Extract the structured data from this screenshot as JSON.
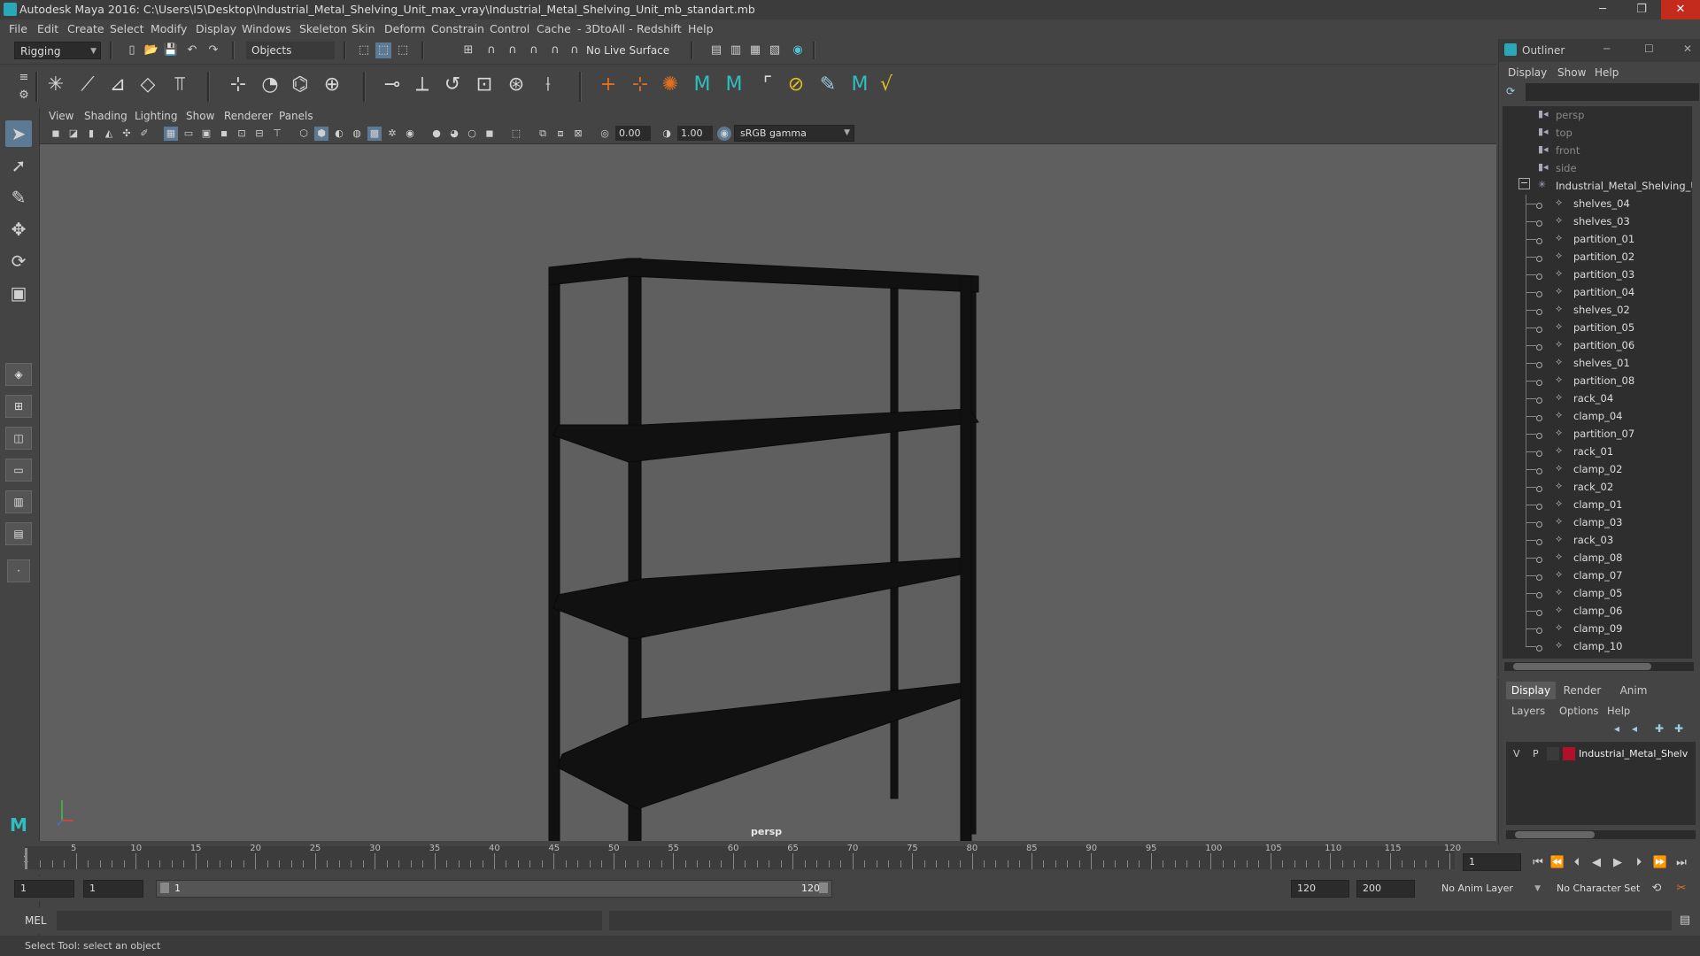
{
  "window": {
    "title": "Autodesk Maya 2016: C:\\Users\\I5\\Desktop\\Industrial_Metal_Shelving_Unit_max_vray\\Industrial_Metal_Shelving_Unit_mb_standart.mb",
    "min": "─",
    "max": "❐",
    "close": "✕"
  },
  "menubar": [
    "File",
    "Edit",
    "Create",
    "Select",
    "Modify",
    "Display",
    "Windows",
    "Skeleton",
    "Skin",
    "Deform",
    "Constrain",
    "Control",
    "Cache",
    "- 3DtoAll -",
    "Redshift",
    "Help"
  ],
  "statusline": {
    "mode": "Rigging",
    "select_mode": "Objects",
    "live_surface": "No Live Surface"
  },
  "viewport": {
    "menu": [
      "View",
      "Shading",
      "Lighting",
      "Show",
      "Renderer",
      "Panels"
    ],
    "exposure": "0.00",
    "gamma": "1.00",
    "color_space": "sRGB gamma",
    "camera_label": "persp"
  },
  "timeslider": {
    "ticks": [
      5,
      10,
      15,
      20,
      25,
      30,
      35,
      40,
      45,
      50,
      55,
      60,
      65,
      70,
      75,
      80,
      85,
      90,
      95,
      100,
      105,
      110,
      115,
      120
    ],
    "start_label": "1",
    "current_frame": "1"
  },
  "rangeslider": {
    "start": "1",
    "playback_start": "1",
    "bar_start": "1",
    "bar_end": "120",
    "playback_end": "120",
    "end": "200",
    "anim_layer": "No Anim Layer",
    "char_set": "No Character Set"
  },
  "cmdline": {
    "label": "MEL"
  },
  "helpline": {
    "text": "Select Tool: select an object"
  },
  "outliner": {
    "title": "Outliner",
    "menu": [
      "Display",
      "Show",
      "Help"
    ],
    "cameras": [
      "persp",
      "top",
      "front",
      "side"
    ],
    "root": "Industrial_Metal_Shelving_Uni",
    "children": [
      "shelves_04",
      "shelves_03",
      "partition_01",
      "partition_02",
      "partition_03",
      "partition_04",
      "shelves_02",
      "partition_05",
      "partition_06",
      "shelves_01",
      "partition_08",
      "rack_04",
      "clamp_04",
      "partition_07",
      "rack_01",
      "clamp_02",
      "rack_02",
      "clamp_01",
      "clamp_03",
      "rack_03",
      "clamp_08",
      "clamp_07",
      "clamp_05",
      "clamp_06",
      "clamp_09",
      "clamp_10"
    ]
  },
  "layer_editor": {
    "tabs": [
      "Display",
      "Render",
      "Anim"
    ],
    "menu": [
      "Layers",
      "Options",
      "Help"
    ],
    "layer": {
      "v": "V",
      "p": "P",
      "name": "Industrial_Metal_Shelv",
      "color": "#b0102a"
    }
  },
  "colors": {
    "accent": "#5d7a94",
    "close": "#c42b1c"
  }
}
